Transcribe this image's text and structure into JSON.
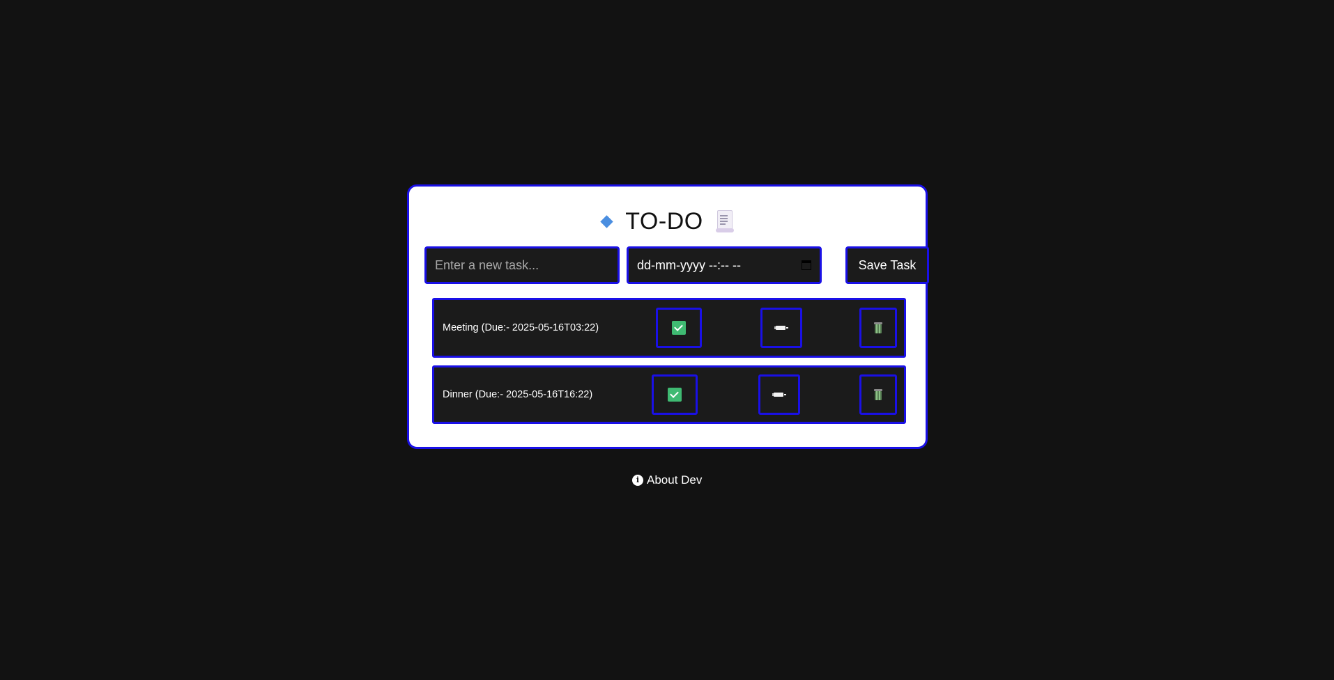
{
  "header": {
    "title": "TO-DO",
    "leading_icon": "blue-diamond-icon",
    "trailing_icon": "scroll-icon"
  },
  "form": {
    "task_placeholder": "Enter a new task...",
    "task_value": "",
    "date_placeholder": "dd-mm-yyyy --:-- --",
    "save_label": "Save Task"
  },
  "tasks": [
    {
      "text": "Meeting (Due:- 2025-05-16T03:22)",
      "complete_icon": "check-icon",
      "edit_icon": "pencil-icon",
      "delete_icon": "trash-icon"
    },
    {
      "text": "Dinner (Due:- 2025-05-16T16:22)",
      "complete_icon": "check-icon",
      "edit_icon": "pencil-icon",
      "delete_icon": "trash-icon"
    }
  ],
  "footer": {
    "about_label": "About Dev",
    "about_icon": "info-icon"
  },
  "colors": {
    "page_background": "#121212",
    "card_background": "#ffffff",
    "accent_border": "#1a10e6",
    "control_background": "#1b1b1b",
    "check_green": "#3fba72"
  }
}
